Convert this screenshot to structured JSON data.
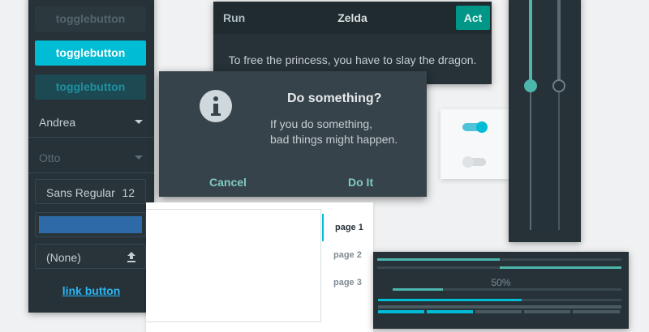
{
  "colors": {
    "accent": "#00bcd4",
    "teal": "#009688",
    "progress": "#4db6ac",
    "dark_panel": "#263238",
    "link": "#29b6f6",
    "selection": "#2d6aa7"
  },
  "left_panel": {
    "toggle_buttons": [
      {
        "label": "togglebutton",
        "state": "insensitive"
      },
      {
        "label": "togglebutton",
        "state": "active"
      },
      {
        "label": "togglebutton",
        "state": "inactive"
      }
    ],
    "combo_primary": {
      "value": "Andrea"
    },
    "combo_disabled": {
      "value": "Otto"
    },
    "font_button": {
      "name": "Sans Regular",
      "size": "12"
    },
    "file_chooser": {
      "label": "(None)",
      "icon": "upload-icon"
    },
    "link_button": {
      "label": "link button"
    }
  },
  "headerbar_window": {
    "left_button": "Run",
    "title": "Zelda",
    "right_button": "Act",
    "body_text": "To free the princess, you have to slay the dragon."
  },
  "dialog": {
    "icon": "info-icon",
    "title": "Do something?",
    "message_line1": "If you do something,",
    "message_line2": "bad things might happen.",
    "cancel_label": "Cancel",
    "confirm_label": "Do It"
  },
  "switches": [
    {
      "state": "on"
    },
    {
      "state": "off"
    }
  ],
  "scales": [
    {
      "orientation": "vertical",
      "value_fraction": 0.65,
      "active": true
    },
    {
      "orientation": "vertical",
      "value_fraction": 0.65,
      "active": false
    }
  ],
  "notebook": {
    "tabs": [
      {
        "label": "page 1",
        "active": true
      },
      {
        "label": "page 2",
        "active": false
      },
      {
        "label": "page 3",
        "active": false
      }
    ]
  },
  "progress": {
    "label": "50%",
    "bar1_fraction": 0.5,
    "bar2_start_fraction": 0.5,
    "bar3_fraction": 0.27,
    "bar4_fraction": 0.59,
    "level_blocks_total": 5,
    "level_blocks_filled": 2
  }
}
